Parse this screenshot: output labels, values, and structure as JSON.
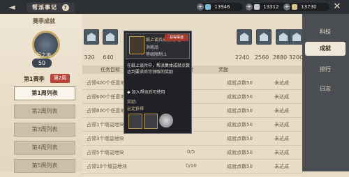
{
  "window": {
    "title": "帮派事记",
    "help": "?"
  },
  "currencies": [
    {
      "name": "jade",
      "value": "13946",
      "color": "#7fb9d6"
    },
    {
      "name": "silver",
      "value": "13312",
      "color": "#c8c8c8"
    },
    {
      "name": "gold-token",
      "value": "13730",
      "color": "#d8c48a"
    }
  ],
  "left": {
    "season_title": "赛季成就",
    "badge_name": "立恒之地",
    "badge_level": "50",
    "season_label": "第1赛季",
    "season_tag": "第2周",
    "weeks": [
      {
        "label": "第1周列表",
        "active": true
      },
      {
        "label": "第2周列表",
        "active": false
      },
      {
        "label": "第3周列表",
        "active": false
      },
      {
        "label": "第4周列表",
        "active": false
      },
      {
        "label": "第5周列表",
        "active": false
      }
    ]
  },
  "nav": {
    "tabs": [
      "科技",
      "成就",
      "排行",
      "日志"
    ],
    "active": 1
  },
  "chests": {
    "values": [
      "320",
      "640",
      "",
      "",
      "",
      "",
      "2240",
      "2560",
      "2880",
      "3200"
    ]
  },
  "table": {
    "headers": [
      "任务目标",
      "进度",
      "奖励",
      ""
    ],
    "rows": [
      {
        "goal": "占领400个任意地块",
        "progress": "",
        "reward": "成就点数50",
        "status": "未达成"
      },
      {
        "goal": "占领600个任意地块",
        "progress": "",
        "reward": "成就点数50",
        "status": "未达成"
      },
      {
        "goal": "占领800个任意地块",
        "progress": "",
        "reward": "成就点数50",
        "status": "未达成"
      },
      {
        "goal": "占领1个增益地块",
        "progress": "",
        "reward": "成就点数50",
        "status": "未达成"
      },
      {
        "goal": "占领3个增益地块",
        "progress": "",
        "reward": "成就点数50",
        "status": "未达成"
      },
      {
        "goal": "占领5个增益地块",
        "progress": "0/5",
        "reward": "成就点数50",
        "status": "未达成"
      },
      {
        "goal": "占领10个增益地块",
        "progress": "0/10",
        "reward": "成就点数50",
        "status": "未达成"
      }
    ]
  },
  "tooltip": {
    "item_name": "纸上谈兵成就礼·七",
    "item_type": "消耗品",
    "limit": "等级限制:1",
    "claim_button": "获得渠道",
    "description": "在纸上谈兵中，帮派集体成就点数达到要求后可领取的奖励",
    "tip": "◆ 加入帮派后可使用",
    "reward_label": "奖励:",
    "reward_sub": "必定获得"
  }
}
